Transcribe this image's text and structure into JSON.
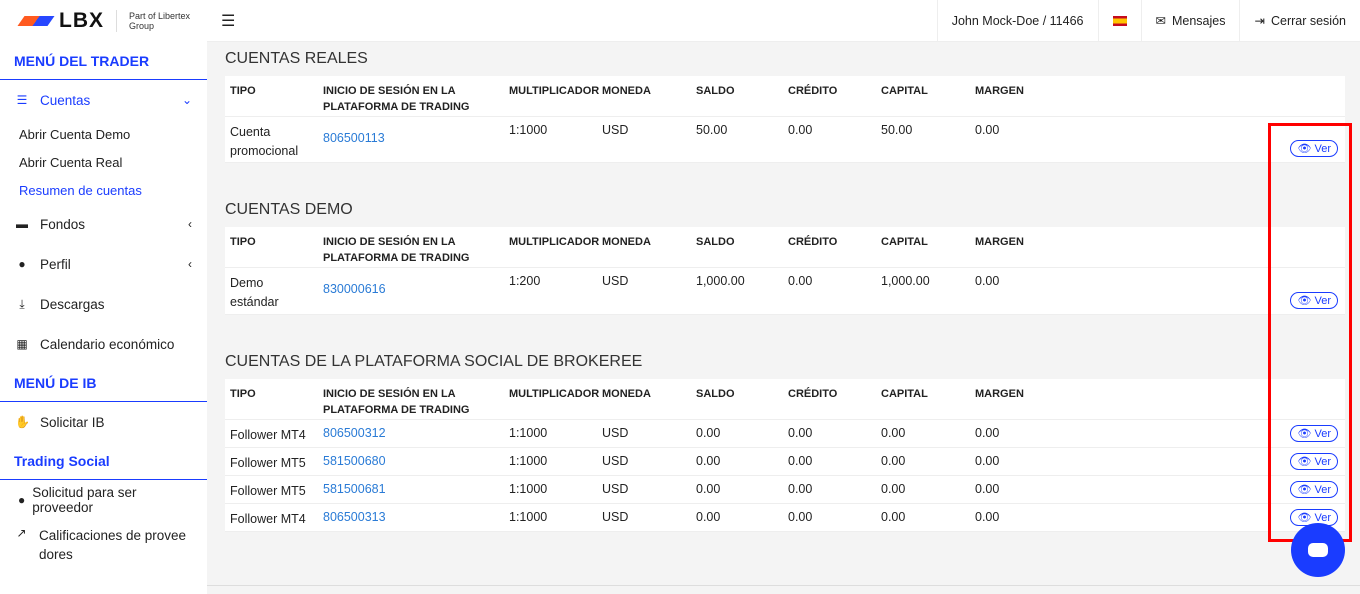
{
  "logo": {
    "brand": "LBX",
    "tagline": "Part of Libertex Group"
  },
  "header": {
    "user": "John Mock-Doe / 11466",
    "messages": "Mensajes",
    "logout": "Cerrar sesión"
  },
  "sidebar": {
    "trader_title": "MENÚ DEL TRADER",
    "cuentas": "Cuentas",
    "sub": [
      "Abrir Cuenta Demo",
      "Abrir Cuenta Real",
      "Resumen de cuentas"
    ],
    "fondos": "Fondos",
    "perfil": "Perfil",
    "descargas": "Descargas",
    "calendario": "Calendario económico",
    "ib_title": "MENÚ DE IB",
    "solicitar_ib": "Solicitar IB",
    "social_title": "Trading Social",
    "proveedor": "Solicitud para ser proveedor",
    "calificaciones": "Calificaciones de proveedores"
  },
  "columns": [
    "TIPO",
    "INICIO DE SESIÓN EN LA PLATAFORMA DE TRADING",
    "MULTIPLICADOR",
    "MONEDA",
    "SALDO",
    "CRÉDITO",
    "CAPITAL",
    "MARGEN"
  ],
  "ver_label": "Ver",
  "sections": [
    {
      "title": "CUENTAS REALES",
      "rows": [
        [
          "Cuenta promocional",
          "806500113",
          "1:1000",
          "USD",
          "50.00",
          "0.00",
          "50.00",
          "0.00"
        ]
      ]
    },
    {
      "title": "CUENTAS DEMO",
      "rows": [
        [
          "Demo estándar",
          "830000616",
          "1:200",
          "USD",
          "1,000.00",
          "0.00",
          "1,000.00",
          "0.00"
        ]
      ]
    },
    {
      "title": "CUENTAS DE LA PLATAFORMA SOCIAL DE BROKEREE",
      "rows": [
        [
          "Follower MT4",
          "806500312",
          "1:1000",
          "USD",
          "0.00",
          "0.00",
          "0.00",
          "0.00"
        ],
        [
          "Follower MT5",
          "581500680",
          "1:1000",
          "USD",
          "0.00",
          "0.00",
          "0.00",
          "0.00"
        ],
        [
          "Follower MT5",
          "581500681",
          "1:1000",
          "USD",
          "0.00",
          "0.00",
          "0.00",
          "0.00"
        ],
        [
          "Follower MT4",
          "806500313",
          "1:1000",
          "USD",
          "0.00",
          "0.00",
          "0.00",
          "0.00"
        ]
      ]
    }
  ],
  "colors": {
    "accent": "#1a3cff",
    "link": "#2a7bd6",
    "highlight": "#ff0000"
  }
}
